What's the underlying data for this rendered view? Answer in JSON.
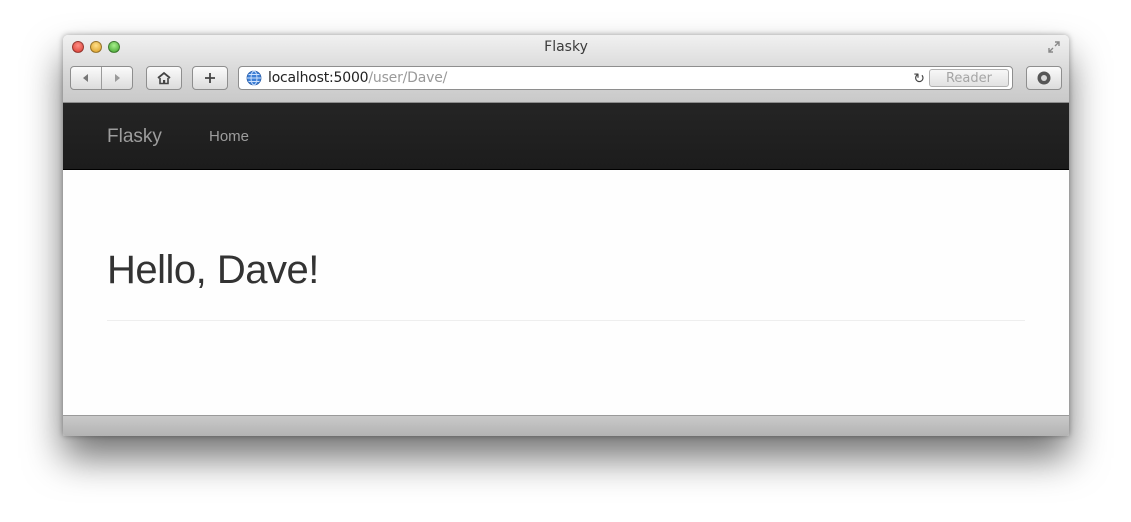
{
  "window": {
    "title": "Flasky"
  },
  "toolbar": {
    "url_host": "localhost:5000",
    "url_path": "/user/Dave/",
    "reader_label": "Reader",
    "reload_glyph": "↻"
  },
  "navbar": {
    "brand": "Flasky",
    "links": [
      {
        "label": "Home"
      }
    ]
  },
  "page": {
    "heading": "Hello, Dave!"
  },
  "icons": [
    "back-icon",
    "forward-icon",
    "home-icon",
    "plus-icon",
    "globe-icon",
    "reload-icon",
    "download-icon",
    "resize-icon"
  ]
}
